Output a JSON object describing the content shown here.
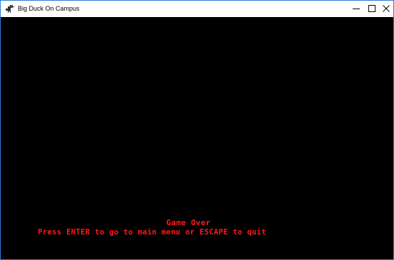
{
  "window": {
    "title": "Big Duck On Campus",
    "icon": "duck-app-icon",
    "controls": {
      "minimize_icon": "minimize-icon",
      "maximize_icon": "maximize-icon",
      "close_icon": "close-icon"
    }
  },
  "game": {
    "background_color": "#000000",
    "text_color": "#ff1a1a",
    "game_over": "Game Over",
    "prompt": "Press ENTER to go to main menu or ESCAPE to quit"
  }
}
